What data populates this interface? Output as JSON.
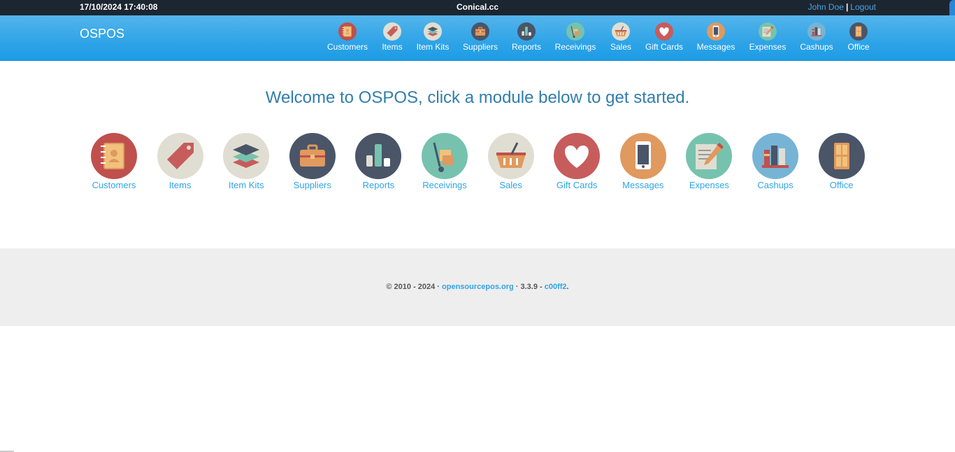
{
  "topbar": {
    "datetime": "17/10/2024 17:40:08",
    "site": "Conical.cc",
    "user": "John Doe",
    "separator": "|",
    "logout": "Logout"
  },
  "brand": "OSPOS",
  "nav": [
    {
      "label": "Customers",
      "icon": "customers-icon"
    },
    {
      "label": "Items",
      "icon": "items-icon"
    },
    {
      "label": "Item Kits",
      "icon": "item-kits-icon"
    },
    {
      "label": "Suppliers",
      "icon": "suppliers-icon"
    },
    {
      "label": "Reports",
      "icon": "reports-icon"
    },
    {
      "label": "Receivings",
      "icon": "receivings-icon"
    },
    {
      "label": "Sales",
      "icon": "sales-icon"
    },
    {
      "label": "Gift Cards",
      "icon": "gift-cards-icon"
    },
    {
      "label": "Messages",
      "icon": "messages-icon"
    },
    {
      "label": "Expenses",
      "icon": "expenses-icon"
    },
    {
      "label": "Cashups",
      "icon": "cashups-icon"
    },
    {
      "label": "Office",
      "icon": "office-icon"
    }
  ],
  "welcome": "Welcome to OSPOS, click a module below to get started.",
  "modules": [
    {
      "label": "Customers",
      "icon": "customers-icon",
      "color": "#c0504d"
    },
    {
      "label": "Items",
      "icon": "items-icon",
      "color": "#e0ded2"
    },
    {
      "label": "Item Kits",
      "icon": "item-kits-icon",
      "color": "#e0ded2"
    },
    {
      "label": "Suppliers",
      "icon": "suppliers-icon",
      "color": "#4a5568"
    },
    {
      "label": "Reports",
      "icon": "reports-icon",
      "color": "#4a5568"
    },
    {
      "label": "Receivings",
      "icon": "receivings-icon",
      "color": "#76c2af"
    },
    {
      "label": "Sales",
      "icon": "sales-icon",
      "color": "#e0ded2"
    },
    {
      "label": "Gift Cards",
      "icon": "gift-cards-icon",
      "color": "#c75c5c"
    },
    {
      "label": "Messages",
      "icon": "messages-icon",
      "color": "#e0995e"
    },
    {
      "label": "Expenses",
      "icon": "expenses-icon",
      "color": "#76c2af"
    },
    {
      "label": "Cashups",
      "icon": "cashups-icon",
      "color": "#77b3d4"
    },
    {
      "label": "Office",
      "icon": "office-icon",
      "color": "#4a5568"
    }
  ],
  "footer": {
    "copyright": "© 2010 - 2024 · ",
    "link": "opensourcepos.org",
    "version": " · 3.3.9 - ",
    "commit": "c00ff2",
    "end": "."
  }
}
